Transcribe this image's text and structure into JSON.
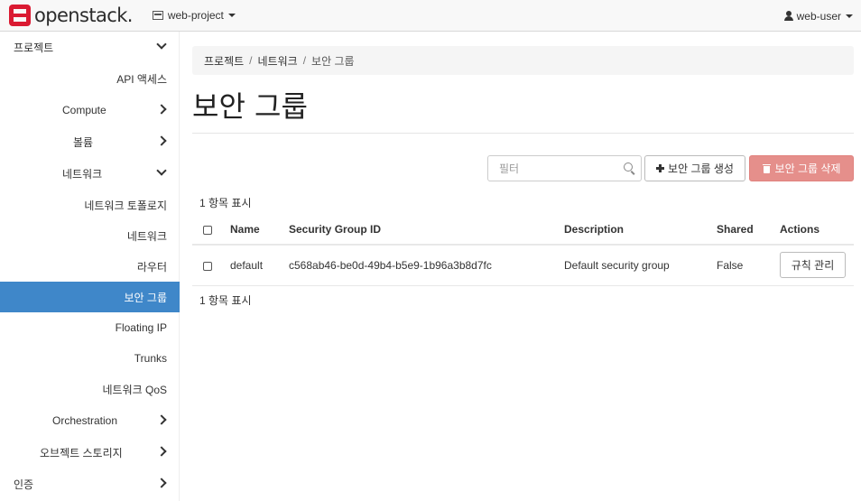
{
  "brand": {
    "name": "openstack."
  },
  "project_picker": {
    "label": "web-project"
  },
  "user_menu": {
    "label": "web-user"
  },
  "sidebar": {
    "items": [
      {
        "label": "프로젝트"
      },
      {
        "label": "API 액세스"
      },
      {
        "label": "Compute"
      },
      {
        "label": "볼륨"
      },
      {
        "label": "네트워크"
      },
      {
        "label": "네트워크 토폴로지"
      },
      {
        "label": "네트워크"
      },
      {
        "label": "라우터"
      },
      {
        "label": "보안 그룹"
      },
      {
        "label": "Floating IP"
      },
      {
        "label": "Trunks"
      },
      {
        "label": "네트워크 QoS"
      },
      {
        "label": "Orchestration"
      },
      {
        "label": "오브젝트 스토리지"
      },
      {
        "label": "인증"
      }
    ]
  },
  "breadcrumb": {
    "items": [
      "프로젝트",
      "네트워크"
    ],
    "current": "보안 그룹",
    "separator": "/"
  },
  "page": {
    "title": "보안 그룹"
  },
  "toolbar": {
    "filter_placeholder": "필터",
    "create_label": "보안 그룹 생성",
    "delete_label": "보안 그룹 삭제"
  },
  "table": {
    "count_top": "1 항목 표시",
    "count_bottom": "1 항목 표시",
    "columns": [
      "Name",
      "Security Group ID",
      "Description",
      "Shared",
      "Actions"
    ],
    "rows": [
      {
        "name": "default",
        "id": "c568ab46-be0d-49b4-b5e9-1b96a3b8d7fc",
        "description": "Default security group",
        "shared": "False",
        "action": "규칙 관리"
      }
    ]
  },
  "colors": {
    "active": "#3f87c9",
    "danger": "#e58f8b",
    "brand": "#da1a32"
  }
}
